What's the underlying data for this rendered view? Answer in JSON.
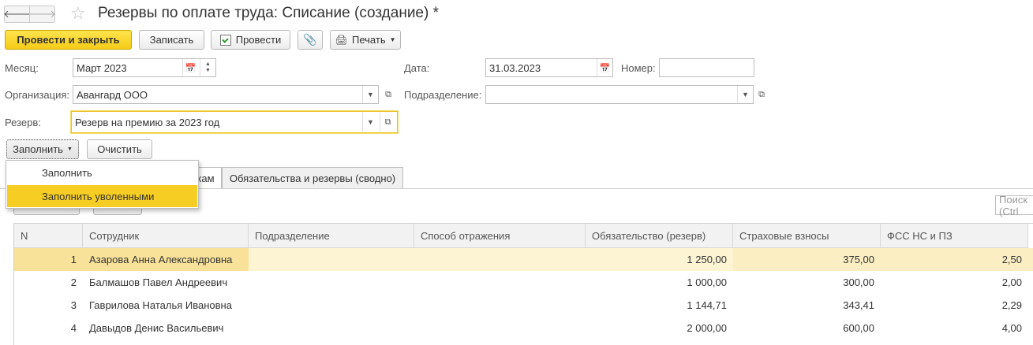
{
  "window": {
    "title": "Резервы по оплате труда: Списание (создание) *"
  },
  "toolbar": {
    "post_close_label": "Провести и закрыть",
    "save_label": "Записать",
    "post_label": "Провести",
    "print_label": "Печать"
  },
  "form": {
    "month_label": "Месяц:",
    "month_value": "Март 2023",
    "date_label": "Дата:",
    "date_value": "31.03.2023",
    "number_label": "Номер:",
    "number_value": "",
    "org_label": "Организация:",
    "org_value": "Авангард ООО",
    "dept_label": "Подразделение:",
    "dept_value": "",
    "reserve_label": "Резерв:",
    "reserve_value": "Резерв на премию за 2023 год"
  },
  "actions": {
    "fill_label": "Заполнить",
    "clear_label": "Очистить"
  },
  "menu": {
    "items": [
      "Заполнить",
      "Заполнить уволенными"
    ]
  },
  "tabs": [
    {
      "label": "кам"
    },
    {
      "label": "Обязательства и резервы (сводно)"
    }
  ],
  "search": {
    "placeholder": "Поиск (Ctrl"
  },
  "table": {
    "columns": [
      "N",
      "Сотрудник",
      "Подразделение",
      "Способ отражения",
      "Обязательство (резерв)",
      "Страховые взносы",
      "ФСС НС и ПЗ"
    ],
    "rows": [
      {
        "n": "1",
        "employee": "Азарова Анна Александровна",
        "dept": "",
        "method": "",
        "obligation": "1 250,00",
        "insurance": "375,00",
        "fss": "2,50"
      },
      {
        "n": "2",
        "employee": "Балмашов Павел Андреевич",
        "dept": "",
        "method": "",
        "obligation": "1 000,00",
        "insurance": "300,00",
        "fss": "2,00"
      },
      {
        "n": "3",
        "employee": "Гаврилова Наталья Ивановна",
        "dept": "",
        "method": "",
        "obligation": "1 144,71",
        "insurance": "343,41",
        "fss": "2,29"
      },
      {
        "n": "4",
        "employee": "Давыдов Денис Васильевич",
        "dept": "",
        "method": "",
        "obligation": "2 000,00",
        "insurance": "600,00",
        "fss": "4,00"
      }
    ]
  },
  "colors": {
    "accent_yellow": "#f5cc17",
    "selected_row": "#fbeec2",
    "menu_highlight": "#f6cd22"
  }
}
